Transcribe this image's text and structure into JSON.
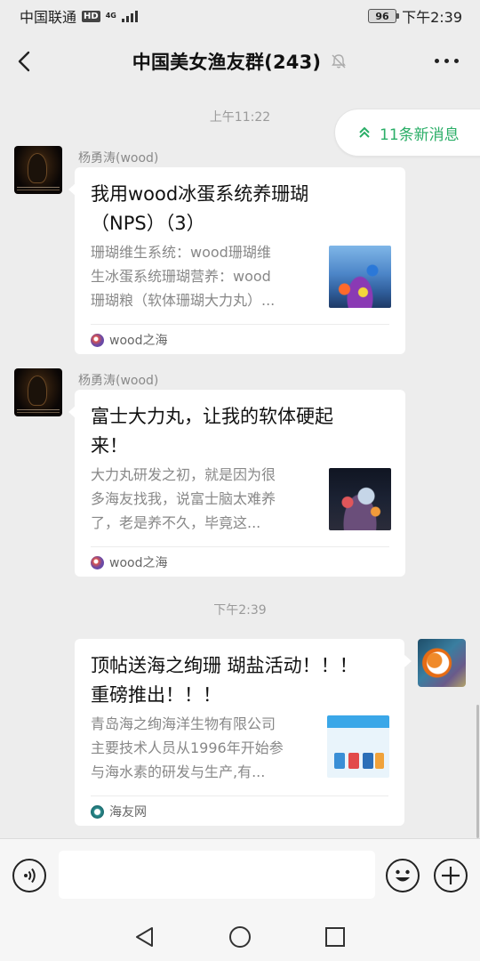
{
  "status_bar": {
    "carrier": "中国联通",
    "hd": "HD",
    "net_type_top": "4G",
    "net_type_bottom": "tll",
    "battery": "96",
    "time": "下午2:39"
  },
  "header": {
    "title": "中国美女渔友群(243)"
  },
  "new_messages_pill": {
    "label": "11条新消息",
    "accent_color": "#2aae67"
  },
  "messages": [
    {
      "time_label": "上午11:22",
      "sender": "杨勇涛(wood)",
      "card": {
        "title_line1": "我用wood冰蛋系统养珊瑚",
        "title_line2": "（NPS）（3）",
        "desc_line1": "珊瑚维生系统：wood珊瑚维",
        "desc_line2": "生冰蛋系统珊瑚营养：wood",
        "desc_line3": "珊瑚粮（软体珊瑚大力丸）...",
        "source": "wood之海",
        "thumb_icon": "coral-reef-thumbnail"
      }
    },
    {
      "sender": "杨勇涛(wood)",
      "card": {
        "title_line1": "富士大力丸，让我的软体硬起",
        "title_line2": "来！",
        "desc_line1": "大力丸研发之初，就是因为很",
        "desc_line2": "多海友找我，说富士脑太难养",
        "desc_line3": "了，老是养不久，毕竟这...",
        "source": "wood之海",
        "thumb_icon": "coral-tank-thumbnail"
      }
    },
    {
      "time_label": "下午2:39",
      "card": {
        "title_line1": "顶帖送海之绚珊 瑚盐活动！！！",
        "title_line2": "重磅推出！！！",
        "desc_line1": "青岛海之绚海洋生物有限公司",
        "desc_line2": "主要技术人员从1996年开始参",
        "desc_line3": "与海水素的研发与生产,有...",
        "source": "海友网",
        "thumb_icon": "product-thumbnail"
      }
    }
  ],
  "input_bar": {
    "placeholder": ""
  }
}
